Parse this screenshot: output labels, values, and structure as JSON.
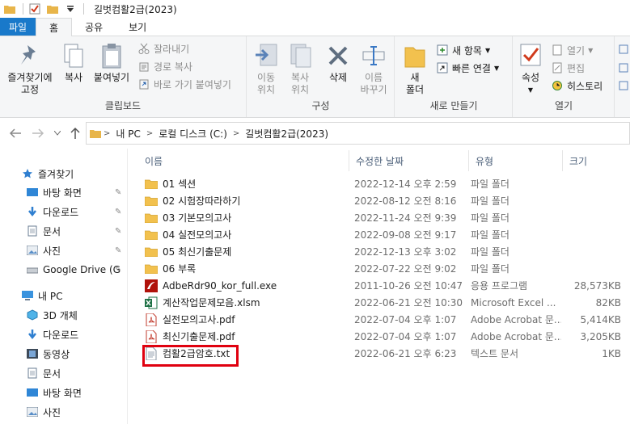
{
  "window": {
    "title": "길벗컴활2급(2023)"
  },
  "tabs": [
    "파일",
    "홈",
    "공유",
    "보기"
  ],
  "ribbon": {
    "clipboard": {
      "label": "클립보드",
      "pin": "즐겨찾기에\n고정",
      "copy": "복사",
      "paste": "붙여넣기",
      "cut": "잘라내기",
      "copy_path": "경로 복사",
      "paste_shortcut": "바로 가기 붙여넣기"
    },
    "organize": {
      "label": "구성",
      "move": "이동\n위치",
      "copyto": "복사\n위치",
      "delete": "삭제",
      "rename": "이름\n바꾸기"
    },
    "new": {
      "label": "새로 만들기",
      "folder": "새\n폴더",
      "new_item": "새 항목",
      "easy_access": "빠른 연결"
    },
    "open": {
      "label": "열기",
      "properties": "속성",
      "open": "열기",
      "edit": "편집",
      "history": "히스토리"
    }
  },
  "address": {
    "crumbs": [
      "내 PC",
      "로컬 디스크 (C:)",
      "길벗컴활2급(2023)"
    ]
  },
  "nav": {
    "quick_access": "즐겨찾기",
    "desktop": "바탕 화면",
    "downloads": "다운로드",
    "documents": "문서",
    "pictures": "사진",
    "gdrive": "Google Drive (G",
    "thispc": "내 PC",
    "objects3d": "3D 개체",
    "downloads2": "다운로드",
    "videos": "동영상",
    "documents2": "문서",
    "desktop2": "바탕 화면",
    "pictures2": "사진"
  },
  "columns": {
    "name": "이름",
    "modified": "수정한 날짜",
    "type": "유형",
    "size": "크기"
  },
  "files": [
    {
      "name": "01 섹션",
      "modified": "2022-12-14 오후 2:59",
      "type": "파일 폴더",
      "size": "",
      "icon": "folder"
    },
    {
      "name": "02 시험장따라하기",
      "modified": "2022-08-12 오전 8:16",
      "type": "파일 폴더",
      "size": "",
      "icon": "folder"
    },
    {
      "name": "03 기본모의고사",
      "modified": "2022-11-24 오전 9:39",
      "type": "파일 폴더",
      "size": "",
      "icon": "folder"
    },
    {
      "name": "04 실전모의고사",
      "modified": "2022-09-08 오전 9:17",
      "type": "파일 폴더",
      "size": "",
      "icon": "folder"
    },
    {
      "name": "05 최신기출문제",
      "modified": "2022-12-13 오후 3:02",
      "type": "파일 폴더",
      "size": "",
      "icon": "folder"
    },
    {
      "name": "06 부록",
      "modified": "2022-07-22 오전 9:02",
      "type": "파일 폴더",
      "size": "",
      "icon": "folder"
    },
    {
      "name": "AdbeRdr90_kor_full.exe",
      "modified": "2011-10-26 오전 10:47",
      "type": "응용 프로그램",
      "size": "28,573KB",
      "icon": "exe"
    },
    {
      "name": "계산작업문제모음.xlsm",
      "modified": "2022-06-21 오전 10:30",
      "type": "Microsoft Excel ...",
      "size": "82KB",
      "icon": "excel"
    },
    {
      "name": "실전모의고사.pdf",
      "modified": "2022-07-04 오후 1:07",
      "type": "Adobe Acrobat 문...",
      "size": "5,414KB",
      "icon": "pdf"
    },
    {
      "name": "최신기출문제.pdf",
      "modified": "2022-07-04 오후 1:07",
      "type": "Adobe Acrobat 문...",
      "size": "3,205KB",
      "icon": "pdf"
    },
    {
      "name": "컴활2급암호.txt",
      "modified": "2022-06-21 오후 6:23",
      "type": "텍스트 문서",
      "size": "1KB",
      "icon": "txt"
    }
  ]
}
